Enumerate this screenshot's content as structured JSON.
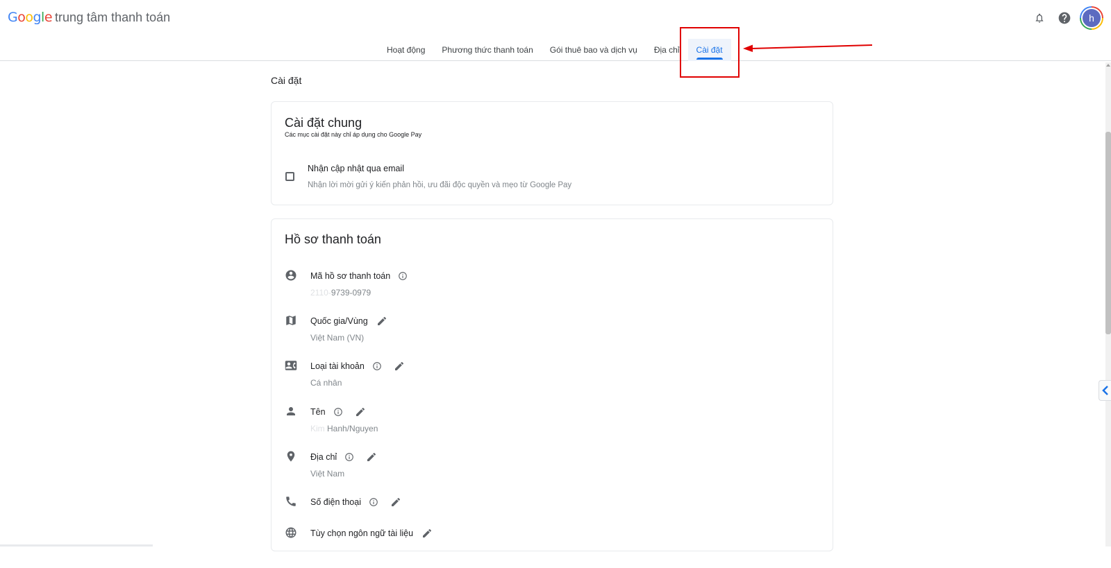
{
  "header": {
    "logo_letters": [
      "G",
      "o",
      "o",
      "g",
      "l",
      "e"
    ],
    "product_name": "trung tâm thanh toán",
    "avatar_letter": "h",
    "icons": [
      "notifications-bell-icon",
      "help-icon",
      "account-avatar"
    ]
  },
  "tabs": [
    {
      "label": "Hoạt động",
      "active": false
    },
    {
      "label": "Phương thức thanh toán",
      "active": false
    },
    {
      "label": "Gói thuê bao và dịch vụ",
      "active": false
    },
    {
      "label": "Địa chỉ",
      "active": false
    },
    {
      "label": "Cài đặt",
      "active": true
    }
  ],
  "page": {
    "title": "Cài đặt"
  },
  "general_settings": {
    "title": "Cài đặt chung",
    "subtitle": "Các mục cài đặt này chỉ áp dụng cho Google Pay",
    "email_updates": {
      "label": "Nhận cập nhật qua email",
      "description": "Nhận lời mời gửi ý kiến phản hồi, ưu đãi độc quyền và mẹo từ Google Pay",
      "checked": false
    }
  },
  "payments_profile": {
    "title": "Hồ sơ thanh toán",
    "rows": [
      {
        "icon": "account-circle-icon",
        "label": "Mã hồ sơ thanh toán",
        "has_info": true,
        "has_edit": false,
        "value_hidden": "2110-",
        "value": "9739-0979"
      },
      {
        "icon": "map-icon",
        "label": "Quốc gia/Vùng",
        "has_info": false,
        "has_edit": true,
        "value_hidden": "",
        "value": "Việt Nam (VN)"
      },
      {
        "icon": "contact-card-icon",
        "label": "Loại tài khoản",
        "has_info": true,
        "has_edit": true,
        "value_hidden": "",
        "value": "Cá nhân"
      },
      {
        "icon": "person-icon",
        "label": "Tên",
        "has_info": true,
        "has_edit": true,
        "value_hidden": "Kim ",
        "value": "Hanh/Nguyen"
      },
      {
        "icon": "location-pin-icon",
        "label": "Địa chỉ",
        "has_info": true,
        "has_edit": true,
        "value_hidden": "",
        "value": "Việt Nam"
      },
      {
        "icon": "phone-icon",
        "label": "Số điện thoại",
        "has_info": true,
        "has_edit": true,
        "value_hidden": "",
        "value": ""
      },
      {
        "icon": "globe-icon",
        "label": "Tùy chọn ngôn ngữ tài liệu",
        "has_info": false,
        "has_edit": true,
        "value_hidden": "",
        "value": ""
      }
    ]
  },
  "colors": {
    "accent": "#1a73e8",
    "annotation": "#e00000"
  }
}
